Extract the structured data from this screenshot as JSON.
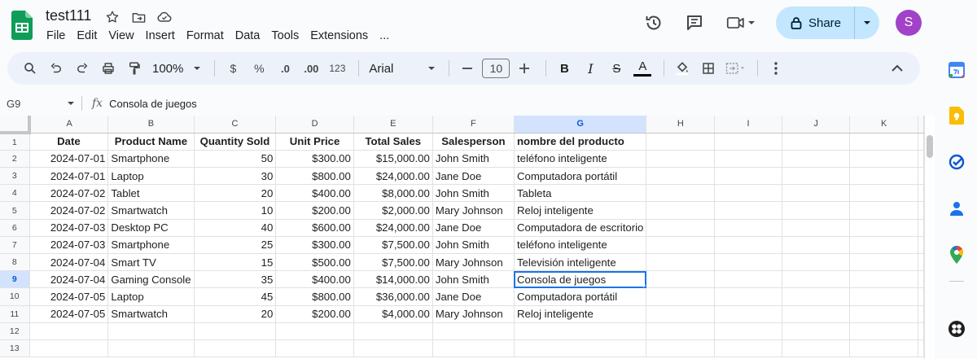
{
  "title": "test111",
  "menu": [
    "File",
    "Edit",
    "View",
    "Insert",
    "Format",
    "Data",
    "Tools",
    "Extensions",
    "..."
  ],
  "share_label": "Share",
  "avatar_initial": "S",
  "toolbar": {
    "zoom": "100%",
    "currency": "$",
    "percent": "%",
    "dec_decrease": ".0",
    "dec_increase": ".00",
    "format_123": "123",
    "font": "Arial",
    "font_size": "10",
    "bold": "B",
    "italic": "I",
    "strike": "S",
    "text_color": "A"
  },
  "formula_bar": {
    "cell_ref": "G9",
    "fx": "fx",
    "value": "Consola de juegos"
  },
  "columns": [
    "A",
    "B",
    "C",
    "D",
    "E",
    "F",
    "G",
    "H",
    "I",
    "J",
    "K"
  ],
  "row_numbers": [
    "1",
    "2",
    "3",
    "4",
    "5",
    "6",
    "7",
    "8",
    "9",
    "10",
    "11",
    "12",
    "13"
  ],
  "header_row": [
    "Date",
    "Product Name",
    "Quantity Sold",
    "Unit Price",
    "Total Sales",
    "Salesperson",
    "nombre del producto"
  ],
  "rows": [
    [
      "2024-07-01",
      "Smartphone",
      "50",
      "$300.00",
      "$15,000.00",
      "John Smith",
      "teléfono inteligente"
    ],
    [
      "2024-07-01",
      "Laptop",
      "30",
      "$800.00",
      "$24,000.00",
      "Jane Doe",
      "Computadora portátil"
    ],
    [
      "2024-07-02",
      "Tablet",
      "20",
      "$400.00",
      "$8,000.00",
      "John Smith",
      "Tableta"
    ],
    [
      "2024-07-02",
      "Smartwatch",
      "10",
      "$200.00",
      "$2,000.00",
      "Mary Johnson",
      "Reloj inteligente"
    ],
    [
      "2024-07-03",
      "Desktop PC",
      "40",
      "$600.00",
      "$24,000.00",
      "Jane Doe",
      "Computadora de escritorio"
    ],
    [
      "2024-07-03",
      "Smartphone",
      "25",
      "$300.00",
      "$7,500.00",
      "John Smith",
      "teléfono inteligente"
    ],
    [
      "2024-07-04",
      "Smart TV",
      "15",
      "$500.00",
      "$7,500.00",
      "Mary Johnson",
      "Televisión inteligente"
    ],
    [
      "2024-07-04",
      "Gaming Console",
      "35",
      "$400.00",
      "$14,000.00",
      "John Smith",
      "Consola de juegos"
    ],
    [
      "2024-07-05",
      "Laptop",
      "45",
      "$800.00",
      "$36,000.00",
      "Jane Doe",
      "Computadora portátil"
    ],
    [
      "2024-07-05",
      "Smartwatch",
      "20",
      "$200.00",
      "$4,000.00",
      "Mary Johnson",
      "Reloj inteligente"
    ]
  ],
  "selected_cell": {
    "col": "G",
    "row": "9"
  },
  "colors": {
    "accent": "#1a73e8",
    "share_bg": "#c2e7ff",
    "avatar": "#a142c8",
    "sheets_green": "#0f9d58"
  }
}
